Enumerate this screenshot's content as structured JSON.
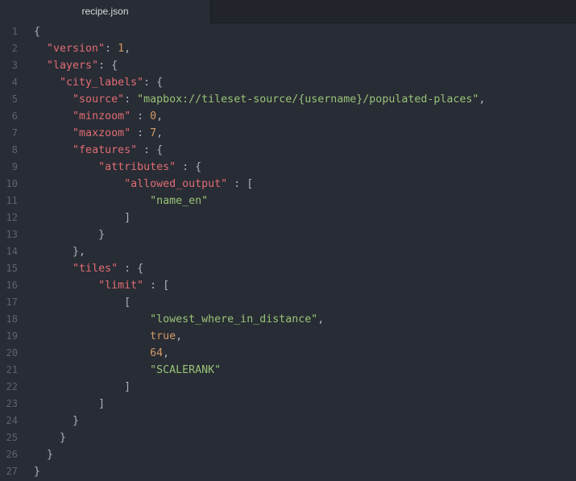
{
  "tab": {
    "title": "recipe.json"
  },
  "colors": {
    "background": "#282c34",
    "key": "#e06c75",
    "string": "#98c379",
    "number": "#d19a66",
    "punctuation": "#abb2bf",
    "gutter": "#5c6370"
  },
  "lines": [
    {
      "num": "1",
      "indent": "",
      "tokens": [
        {
          "t": "p",
          "v": "{"
        }
      ]
    },
    {
      "num": "2",
      "indent": "  ",
      "tokens": [
        {
          "t": "k",
          "v": "\"version\""
        },
        {
          "t": "p",
          "v": ": "
        },
        {
          "t": "n",
          "v": "1"
        },
        {
          "t": "p",
          "v": ","
        }
      ]
    },
    {
      "num": "3",
      "indent": "  ",
      "tokens": [
        {
          "t": "k",
          "v": "\"layers\""
        },
        {
          "t": "p",
          "v": ": {"
        }
      ]
    },
    {
      "num": "4",
      "indent": "    ",
      "tokens": [
        {
          "t": "k",
          "v": "\"city_labels\""
        },
        {
          "t": "p",
          "v": ": {"
        }
      ]
    },
    {
      "num": "5",
      "indent": "      ",
      "tokens": [
        {
          "t": "k",
          "v": "\"source\""
        },
        {
          "t": "p",
          "v": ": "
        },
        {
          "t": "s",
          "v": "\"mapbox://tileset-source/{username}/populated-places\""
        },
        {
          "t": "p",
          "v": ","
        }
      ]
    },
    {
      "num": "6",
      "indent": "      ",
      "tokens": [
        {
          "t": "k",
          "v": "\"minzoom\""
        },
        {
          "t": "p",
          "v": " : "
        },
        {
          "t": "n",
          "v": "0"
        },
        {
          "t": "p",
          "v": ","
        }
      ]
    },
    {
      "num": "7",
      "indent": "      ",
      "tokens": [
        {
          "t": "k",
          "v": "\"maxzoom\""
        },
        {
          "t": "p",
          "v": " : "
        },
        {
          "t": "n",
          "v": "7"
        },
        {
          "t": "p",
          "v": ","
        }
      ]
    },
    {
      "num": "8",
      "indent": "      ",
      "tokens": [
        {
          "t": "k",
          "v": "\"features\""
        },
        {
          "t": "p",
          "v": " : {"
        }
      ]
    },
    {
      "num": "9",
      "indent": "          ",
      "tokens": [
        {
          "t": "k",
          "v": "\"attributes\""
        },
        {
          "t": "p",
          "v": " : {"
        }
      ]
    },
    {
      "num": "10",
      "indent": "              ",
      "tokens": [
        {
          "t": "k",
          "v": "\"allowed_output\""
        },
        {
          "t": "p",
          "v": " : ["
        }
      ]
    },
    {
      "num": "11",
      "indent": "                  ",
      "tokens": [
        {
          "t": "s",
          "v": "\"name_en\""
        }
      ]
    },
    {
      "num": "12",
      "indent": "              ",
      "tokens": [
        {
          "t": "p",
          "v": "]"
        }
      ]
    },
    {
      "num": "13",
      "indent": "          ",
      "tokens": [
        {
          "t": "p",
          "v": "}"
        }
      ]
    },
    {
      "num": "14",
      "indent": "      ",
      "tokens": [
        {
          "t": "p",
          "v": "},"
        }
      ]
    },
    {
      "num": "15",
      "indent": "      ",
      "tokens": [
        {
          "t": "k",
          "v": "\"tiles\""
        },
        {
          "t": "p",
          "v": " : {"
        }
      ]
    },
    {
      "num": "16",
      "indent": "          ",
      "tokens": [
        {
          "t": "k",
          "v": "\"limit\""
        },
        {
          "t": "p",
          "v": " : ["
        }
      ]
    },
    {
      "num": "17",
      "indent": "              ",
      "tokens": [
        {
          "t": "p",
          "v": "["
        }
      ]
    },
    {
      "num": "18",
      "indent": "                  ",
      "tokens": [
        {
          "t": "s",
          "v": "\"lowest_where_in_distance\""
        },
        {
          "t": "p",
          "v": ","
        }
      ]
    },
    {
      "num": "19",
      "indent": "                  ",
      "tokens": [
        {
          "t": "n",
          "v": "true"
        },
        {
          "t": "p",
          "v": ","
        }
      ]
    },
    {
      "num": "20",
      "indent": "                  ",
      "tokens": [
        {
          "t": "n",
          "v": "64"
        },
        {
          "t": "p",
          "v": ","
        }
      ]
    },
    {
      "num": "21",
      "indent": "                  ",
      "tokens": [
        {
          "t": "s",
          "v": "\"SCALERANK\""
        }
      ]
    },
    {
      "num": "22",
      "indent": "              ",
      "tokens": [
        {
          "t": "p",
          "v": "]"
        }
      ]
    },
    {
      "num": "23",
      "indent": "          ",
      "tokens": [
        {
          "t": "p",
          "v": "]"
        }
      ]
    },
    {
      "num": "24",
      "indent": "      ",
      "tokens": [
        {
          "t": "p",
          "v": "}"
        }
      ]
    },
    {
      "num": "25",
      "indent": "    ",
      "tokens": [
        {
          "t": "p",
          "v": "}"
        }
      ]
    },
    {
      "num": "26",
      "indent": "  ",
      "tokens": [
        {
          "t": "p",
          "v": "}"
        }
      ]
    },
    {
      "num": "27",
      "indent": "",
      "tokens": [
        {
          "t": "p",
          "v": "}"
        }
      ]
    }
  ]
}
